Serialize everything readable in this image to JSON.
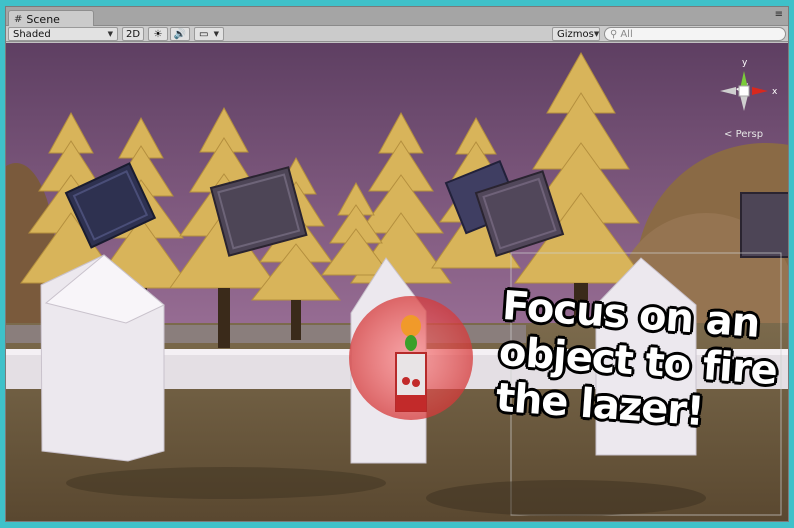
{
  "tab": {
    "label": "Scene",
    "icon": "grid-icon"
  },
  "window_menu": "≡",
  "toolbar": {
    "draw_mode": "Shaded",
    "mode_2d": "2D",
    "lighting_icon": "sun-icon",
    "audio_icon": "speaker-icon",
    "effects_icon": "image-icon",
    "gizmos_label": "Gizmos",
    "search_placeholder": "All",
    "search_icon": "search-icon"
  },
  "viewport": {
    "caption_lines": [
      "Focus on an",
      "object to fire",
      "the lazer!"
    ],
    "projection_label": "Persp",
    "gizmo_axes": {
      "y": "y",
      "x": "x"
    }
  },
  "colors": {
    "frame": "#3fc1c9",
    "sky": "#6a4a6c",
    "ground": "#6e5a3a",
    "tree": "#d8b45a",
    "crate": "#4a4a6a",
    "fence": "#e8e4ea",
    "focus_sphere": "#d63a3a"
  }
}
